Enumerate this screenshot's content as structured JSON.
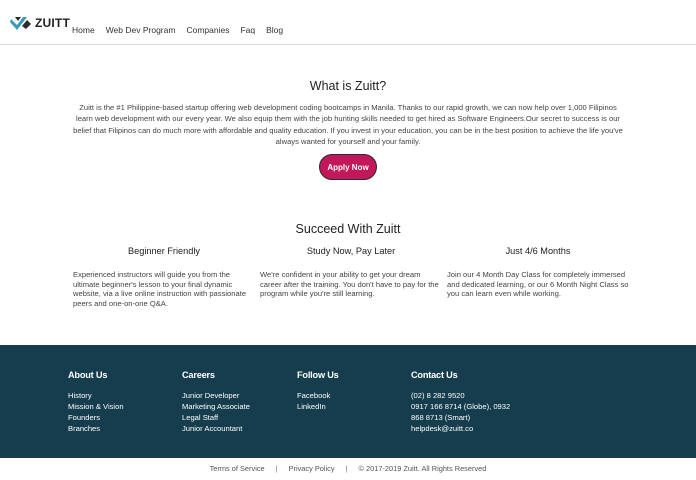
{
  "brand": {
    "name": "ZUITT"
  },
  "nav": {
    "items": [
      "Home",
      "Web Dev Program",
      "Companies",
      "Faq",
      "Blog"
    ]
  },
  "about": {
    "title": "What is Zuitt?",
    "text": "Zuitt is the #1 Philippine-based startup offering web development coding bootcamps in Manila. Thanks to our rapid growth, we can now help over 1,000 Filipinos learn web development with our every year. We also equip them with the job hunting skills needed to get hired as Software Engineers.Our secret to success is our belief that Filipinos can do much more with affordable and quality education. If you invest in your education, you can be in the best position to achieve the life you've always wanted for yourself and your family.",
    "cta_label": "Apply Now"
  },
  "succeed": {
    "title": "Succeed With Zuitt",
    "features": [
      {
        "title": "Beginner Friendly",
        "text": "Experienced instructors will guide you from the ultimate beginner's lesson to your final dynamic website, via a live online instruction with passionate peers and one-on-one Q&A."
      },
      {
        "title": "Study Now, Pay Later",
        "text": "We're confident in your ability to get your dream career after the training. You don't have to pay for the program while you're still learning."
      },
      {
        "title": "Just 4/6 Months",
        "text": "Join our 4 Month Day Class for completely immersed and dedicated learning, or our 6 Month Night Class so you can learn even while working."
      }
    ]
  },
  "footer": {
    "about": {
      "title": "About Us",
      "items": [
        "History",
        "Mission & Vision",
        "Founders",
        "Branches"
      ]
    },
    "careers": {
      "title": "Careers",
      "items": [
        "Junior Developer",
        "Marketing Associate",
        "Legal Staff",
        "Junior Accountant"
      ]
    },
    "follow": {
      "title": "Follow Us",
      "items": [
        "Facebook",
        "LinkedIn"
      ]
    },
    "contact": {
      "title": "Contact Us",
      "items": [
        "(02) 8 282 9520",
        "0917 166 8714 (Globe), 0932",
        "868 8713 (Smart)",
        "helpdesk@zuitt.co"
      ]
    }
  },
  "bottom": {
    "terms": "Terms of Service",
    "separator": "|",
    "privacy": "Privacy Policy",
    "copyright": "© 2017-2019 Zuitt. All Rights Reserved"
  },
  "colors": {
    "accent": "#c2185b",
    "footer_bg": "#153d4d"
  },
  "icons": {
    "logo": "zuitt-logo-icon"
  }
}
